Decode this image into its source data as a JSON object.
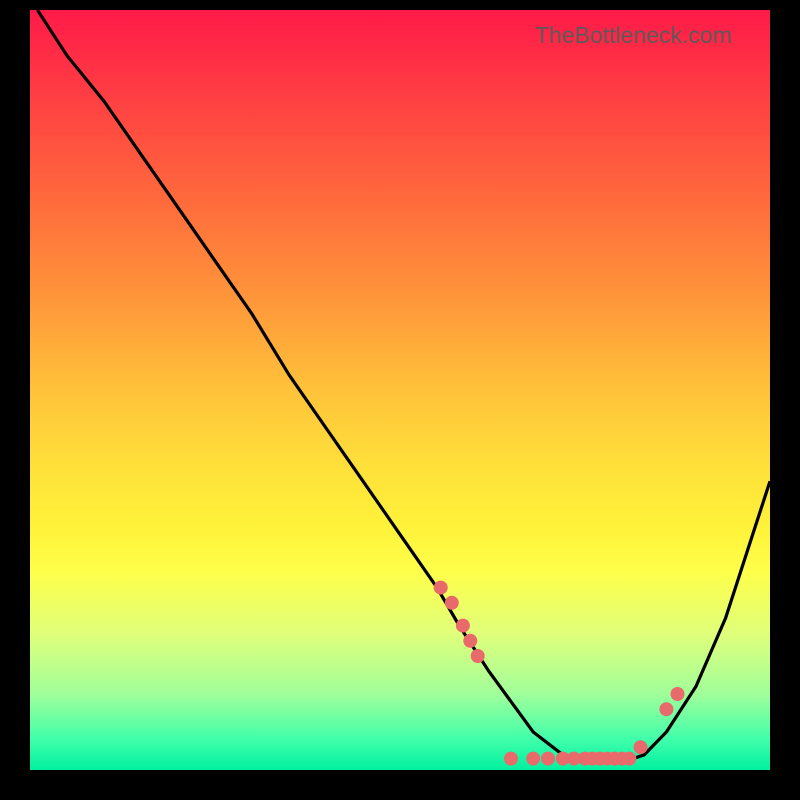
{
  "watermark": "TheBottleneck.com",
  "colors": {
    "curve": "#000000",
    "marker": "#e86a6a",
    "background": "#000000"
  },
  "chart_data": {
    "type": "line",
    "title": "",
    "xlabel": "",
    "ylabel": "",
    "xlim": [
      0,
      100
    ],
    "ylim": [
      0,
      100
    ],
    "curve": {
      "x": [
        1,
        5,
        10,
        15,
        20,
        25,
        30,
        35,
        40,
        45,
        50,
        55,
        58,
        60,
        62,
        65,
        68,
        72,
        75,
        78,
        80,
        83,
        86,
        90,
        94,
        98,
        100
      ],
      "y": [
        100,
        94,
        88,
        81,
        74,
        67,
        60,
        52,
        45,
        38,
        31,
        24,
        19,
        16,
        13,
        9,
        5,
        2,
        1,
        1,
        1,
        2,
        5,
        11,
        20,
        32,
        38
      ]
    },
    "markers": {
      "x": [
        55.5,
        57,
        58.5,
        59.5,
        60.5,
        65,
        68,
        70,
        72,
        73.5,
        75,
        76,
        77,
        78,
        79,
        80,
        81,
        82.5,
        86,
        87.5
      ],
      "y": [
        24,
        22,
        19,
        17,
        15,
        1.5,
        1.5,
        1.5,
        1.5,
        1.5,
        1.5,
        1.5,
        1.5,
        1.5,
        1.5,
        1.5,
        1.5,
        3,
        8,
        10
      ]
    }
  }
}
